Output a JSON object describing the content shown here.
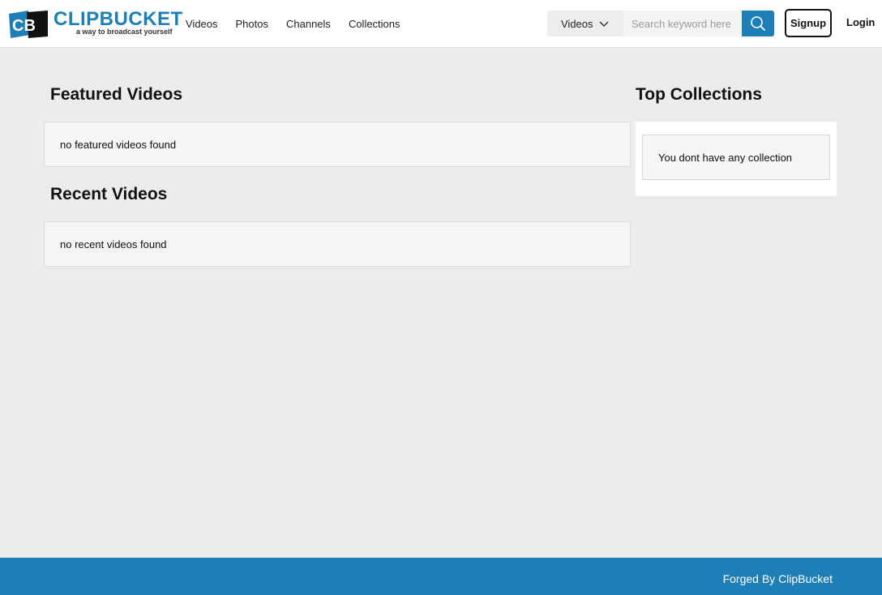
{
  "header": {
    "logo": {
      "wordmark": "CLIPBUCKET",
      "tagline": "a way to broadcast yourself",
      "mark_letters": "CB"
    },
    "nav": [
      {
        "label": "Videos"
      },
      {
        "label": "Photos"
      },
      {
        "label": "Channels"
      },
      {
        "label": "Collections"
      }
    ],
    "search": {
      "type_selected": "Videos",
      "placeholder": "Search keyword here",
      "value": "",
      "button_icon": "search-icon"
    },
    "signup_label": "Signup",
    "login_label": "Login"
  },
  "main": {
    "featured": {
      "title": "Featured Videos",
      "empty_text": "no featured videos found"
    },
    "recent": {
      "title": "Recent Videos",
      "empty_text": "no recent videos found"
    }
  },
  "sidebar": {
    "title": "Top Collections",
    "empty_text": "You dont have any collection"
  },
  "footer": {
    "text": "Forged By ClipBucket"
  },
  "colors": {
    "brand": "#1e7fb6",
    "page_bg": "#ececec",
    "panel_bg": "#f5f5f5"
  }
}
